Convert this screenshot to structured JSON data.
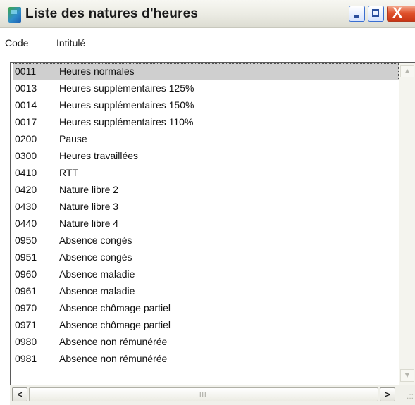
{
  "window": {
    "title": "Liste des natures d'heures",
    "app_icon": "app-icon",
    "controls": {
      "minimize": "_",
      "maximize": "□",
      "close": "X"
    }
  },
  "columns": {
    "code": "Code",
    "intitule": "Intitulé"
  },
  "rows": [
    {
      "code": "0011",
      "label": "Heures normales",
      "selected": true
    },
    {
      "code": "0013",
      "label": "Heures supplémentaires 125%"
    },
    {
      "code": "0014",
      "label": "Heures supplémentaires 150%"
    },
    {
      "code": "0017",
      "label": "Heures supplémentaires 110%"
    },
    {
      "code": "0200",
      "label": "Pause"
    },
    {
      "code": "0300",
      "label": "Heures travaillées"
    },
    {
      "code": "0410",
      "label": "RTT"
    },
    {
      "code": "0420",
      "label": "Nature libre 2"
    },
    {
      "code": "0430",
      "label": "Nature libre 3"
    },
    {
      "code": "0440",
      "label": "Nature libre 4"
    },
    {
      "code": "0950",
      "label": "Absence congés"
    },
    {
      "code": "0951",
      "label": "Absence congés"
    },
    {
      "code": "0960",
      "label": "Absence maladie"
    },
    {
      "code": "0961",
      "label": "Absence maladie"
    },
    {
      "code": "0970",
      "label": "Absence chômage partiel"
    },
    {
      "code": "0971",
      "label": "Absence chômage partiel"
    },
    {
      "code": "0980",
      "label": "Absence non rémunérée"
    },
    {
      "code": "0981",
      "label": "Absence non rémunérée"
    }
  ],
  "scrollbars": {
    "up": "▲",
    "down": "▼",
    "left": "<",
    "right": ">",
    "grip": "III",
    "size_grip": ".::"
  },
  "colors": {
    "selection": "#cfcfcf",
    "close_button": "#e0522c",
    "title_bar": "#ebebe3"
  }
}
